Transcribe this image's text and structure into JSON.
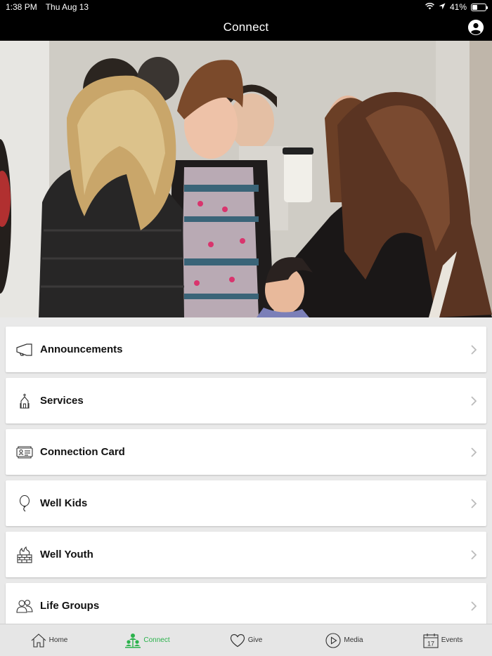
{
  "status": {
    "time": "1:38 PM",
    "date": "Thu Aug 13",
    "battery": "41%",
    "battery_level": 0.41
  },
  "nav": {
    "title": "Connect"
  },
  "menu": {
    "items": [
      {
        "label": "Announcements",
        "icon": "megaphone-icon"
      },
      {
        "label": "Services",
        "icon": "church-icon"
      },
      {
        "label": "Connection Card",
        "icon": "id-card-icon"
      },
      {
        "label": "Well Kids",
        "icon": "balloon-icon"
      },
      {
        "label": "Well Youth",
        "icon": "fire-icon"
      },
      {
        "label": "Life Groups",
        "icon": "people-icon"
      }
    ]
  },
  "tabs": [
    {
      "label": "Home",
      "icon": "home-icon",
      "active": false
    },
    {
      "label": "Connect",
      "icon": "connect-icon",
      "active": true
    },
    {
      "label": "Give",
      "icon": "heart-icon",
      "active": false
    },
    {
      "label": "Media",
      "icon": "play-icon",
      "active": false
    },
    {
      "label": "Events",
      "icon": "calendar-icon",
      "active": false
    }
  ],
  "tab_calendar_day": "17",
  "colors": {
    "accent": "#2bb24c",
    "header": "#000000",
    "background": "#e9e9e9"
  }
}
